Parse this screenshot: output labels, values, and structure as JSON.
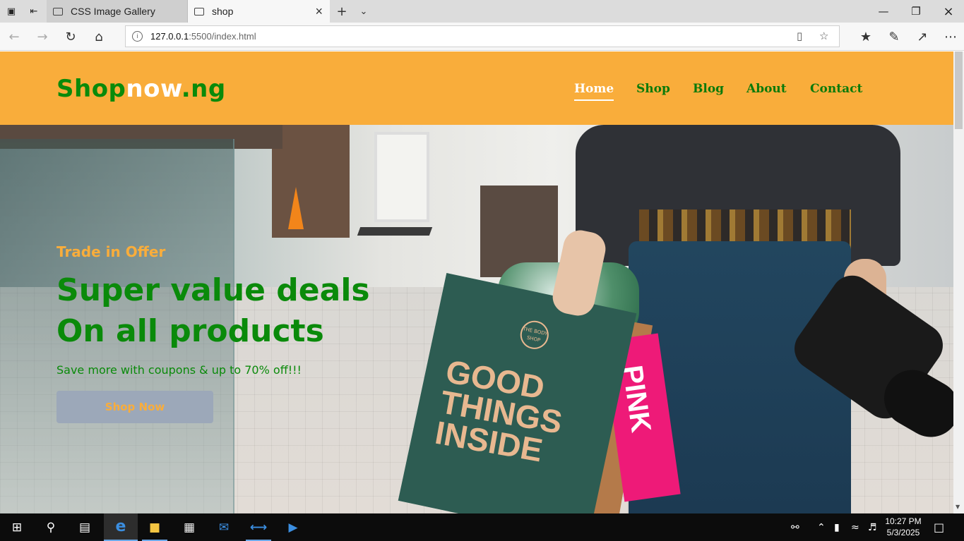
{
  "browser": {
    "tabs": [
      {
        "title": "CSS Image Gallery",
        "active": false
      },
      {
        "title": "shop",
        "active": true
      }
    ],
    "url": "127.0.0.1:5500/index.html",
    "url_host": "127.0.0.1",
    "url_rest": ":5500/index.html"
  },
  "site": {
    "logo_part1": "Shop",
    "logo_part2": "now",
    "logo_part3": ".ng",
    "nav": [
      "Home",
      "Shop",
      "Blog",
      "About",
      "Contact"
    ],
    "active_nav": "Home"
  },
  "hero": {
    "kicker": "Trade in Offer",
    "headline_line1": "Super value deals",
    "headline_line2": "On all products",
    "subtext": "Save more with coupons & up to 70% off!!!",
    "button_label": "Shop Now",
    "bag_text": "GOOD THINGS INSIDE",
    "bag_brand": "THE BODY SHOP",
    "pink_bag_text": "PINK"
  },
  "taskbar": {
    "time": "10:27 PM",
    "date": "5/3/2025"
  },
  "colors": {
    "header_bg": "#f9ad3b",
    "brand_green": "#0a8a0a",
    "accent_orange": "#f9ad3b",
    "button_bg": "#9ca8b9"
  }
}
